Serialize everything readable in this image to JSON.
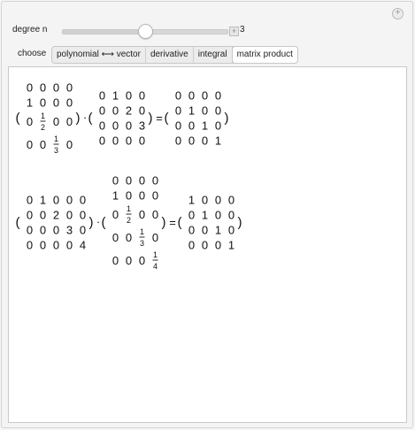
{
  "controls": {
    "degree_label": "degree n",
    "degree_value": "3",
    "degree_fraction": 0.5,
    "choose_label": "choose",
    "tabs": [
      {
        "label": "polynomial ⟷ vector",
        "active": false
      },
      {
        "label": "derivative",
        "active": false
      },
      {
        "label": "integral",
        "active": false
      },
      {
        "label": "matrix product",
        "active": true
      }
    ]
  },
  "equations": [
    {
      "left": [
        [
          "0",
          "0",
          "0",
          "0"
        ],
        [
          "1",
          "0",
          "0",
          "0"
        ],
        [
          "0",
          "1/2",
          "0",
          "0"
        ],
        [
          "0",
          "0",
          "1/3",
          "0"
        ]
      ],
      "right": [
        [
          "0",
          "1",
          "0",
          "0"
        ],
        [
          "0",
          "0",
          "2",
          "0"
        ],
        [
          "0",
          "0",
          "0",
          "3"
        ],
        [
          "0",
          "0",
          "0",
          "0"
        ]
      ],
      "result": [
        [
          "0",
          "0",
          "0",
          "0"
        ],
        [
          "0",
          "1",
          "0",
          "0"
        ],
        [
          "0",
          "0",
          "1",
          "0"
        ],
        [
          "0",
          "0",
          "0",
          "1"
        ]
      ]
    },
    {
      "left": [
        [
          "0",
          "1",
          "0",
          "0",
          "0"
        ],
        [
          "0",
          "0",
          "2",
          "0",
          "0"
        ],
        [
          "0",
          "0",
          "0",
          "3",
          "0"
        ],
        [
          "0",
          "0",
          "0",
          "0",
          "4"
        ]
      ],
      "right": [
        [
          "0",
          "0",
          "0",
          "0"
        ],
        [
          "1",
          "0",
          "0",
          "0"
        ],
        [
          "0",
          "1/2",
          "0",
          "0"
        ],
        [
          "0",
          "0",
          "1/3",
          "0"
        ],
        [
          "0",
          "0",
          "0",
          "1/4"
        ]
      ],
      "result": [
        [
          "1",
          "0",
          "0",
          "0"
        ],
        [
          "0",
          "1",
          "0",
          "0"
        ],
        [
          "0",
          "0",
          "1",
          "0"
        ],
        [
          "0",
          "0",
          "0",
          "1"
        ]
      ]
    }
  ],
  "operators": {
    "dot": "·",
    "equals": "=",
    "lparen": "(",
    "rparen": ")"
  }
}
